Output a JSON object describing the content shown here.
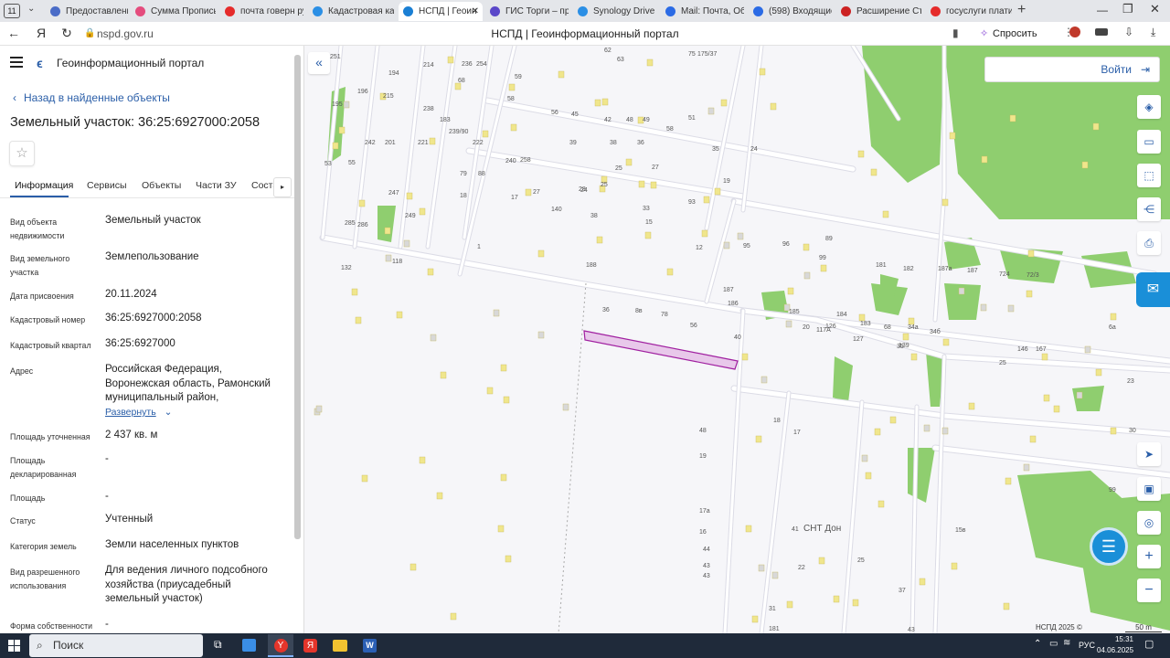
{
  "browser": {
    "tab_count": "11",
    "tabs": [
      {
        "label": "Предоставлени",
        "color": "#4a6cc7"
      },
      {
        "label": "Сумма Прописы",
        "color": "#e44c7d"
      },
      {
        "label": "почта говерн ру",
        "color": "#e52b2b"
      },
      {
        "label": "Кадастровая кар",
        "color": "#2b8fe5"
      },
      {
        "label": "НСПД | Геоин",
        "color": "#1a7fd4"
      },
      {
        "label": "ГИС Торги – про",
        "color": "#5a47c9"
      },
      {
        "label": "Synology Drive",
        "color": "#2b8fe5"
      },
      {
        "label": "Mail: Почта, Обл",
        "color": "#2b6be5"
      },
      {
        "label": "(598) Входящие",
        "color": "#2b6be5"
      },
      {
        "label": "Расширение Стр",
        "color": "#cc2222"
      },
      {
        "label": "госуслуги плати",
        "color": "#e52b2b"
      }
    ],
    "url": "nspd.gov.ru",
    "page_title": "НСПД | Геоинформационный портал",
    "ask_label": "Спросить"
  },
  "sidebar": {
    "portal_name": "Геоинформационный портал",
    "back_link": "Назад в найденные объекты",
    "title": "Земельный участок: 36:25:6927000:2058",
    "tabs": [
      "Информация",
      "Сервисы",
      "Объекты",
      "Части ЗУ",
      "Соста"
    ],
    "fields": [
      {
        "label": "Вид объекта недвижимости",
        "value": "Земельный участок"
      },
      {
        "label": "Вид земельного участка",
        "value": "Землепользование"
      },
      {
        "label": "Дата присвоения",
        "value": "20.11.2024"
      },
      {
        "label": "Кадастровый номер",
        "value": "36:25:6927000:2058"
      },
      {
        "label": "Кадастровый квартал",
        "value": "36:25:6927000"
      },
      {
        "label": "Адрес",
        "value": "Российская Федерация, Воронежская область, Рамонский муниципальный район,"
      },
      {
        "label": "Площадь уточненная",
        "value": "2 437 кв. м"
      },
      {
        "label": "Площадь декларированная",
        "value": "-"
      },
      {
        "label": "Площадь",
        "value": "-"
      },
      {
        "label": "Статус",
        "value": "Учтенный"
      },
      {
        "label": "Категория земель",
        "value": "Земли населенных пунктов"
      },
      {
        "label": "Вид разрешенного использования",
        "value": "Для ведения личного подсобного хозяйства (приусадебный земельный участок)"
      },
      {
        "label": "Форма собственности",
        "value": "-"
      }
    ],
    "expand_label": "Развернуть"
  },
  "map": {
    "login_label": "Войти",
    "place_label": "СНТ Дон",
    "footer_left": "НСПД 2025 ©",
    "footer_scale": "50 m",
    "house_numbers": [
      "251",
      "194",
      "214",
      "236",
      "254",
      "62",
      "63",
      "75",
      "175/37",
      "195",
      "196",
      "215",
      "238",
      "68",
      "59",
      "58",
      "56",
      "45",
      "42",
      "48",
      "49",
      "58",
      "51",
      "53",
      "55",
      "183",
      "239/90",
      "242",
      "201",
      "221",
      "222",
      "39",
      "38",
      "36",
      "35",
      "24",
      "79",
      "88",
      "240",
      "258",
      "24",
      "25",
      "27",
      "28",
      "25",
      "27",
      "19",
      "18",
      "17",
      "140",
      "38",
      "33",
      "93",
      "285",
      "286",
      "247",
      "249",
      "1",
      "15",
      "12",
      "95",
      "96",
      "89",
      "99",
      "181",
      "182",
      "187а",
      "187",
      "724",
      "72/3",
      "6а",
      "132",
      "118",
      "188",
      "187",
      "186",
      "185",
      "184",
      "183",
      "117А",
      "68",
      "34а",
      "34б",
      "35",
      "36",
      "8в",
      "78",
      "56",
      "40",
      "20",
      "126",
      "127",
      "139",
      "146",
      "167",
      "25",
      "23",
      "30",
      "48",
      "19",
      "18",
      "17",
      "17а",
      "16",
      "44",
      "43",
      "43",
      "41",
      "22",
      "25",
      "31",
      "181",
      "43",
      "99",
      "15в",
      "37"
    ],
    "parcel_color": "#a020a0",
    "parcel_fill": "#e8c8ea",
    "road_color": "#dcdce6",
    "green_color": "#8fce6f",
    "house_color": "#f0e68c"
  },
  "taskbar": {
    "search_label": "Поиск",
    "lang": "РУС",
    "time": "15:31",
    "date": "04.06.2025"
  }
}
